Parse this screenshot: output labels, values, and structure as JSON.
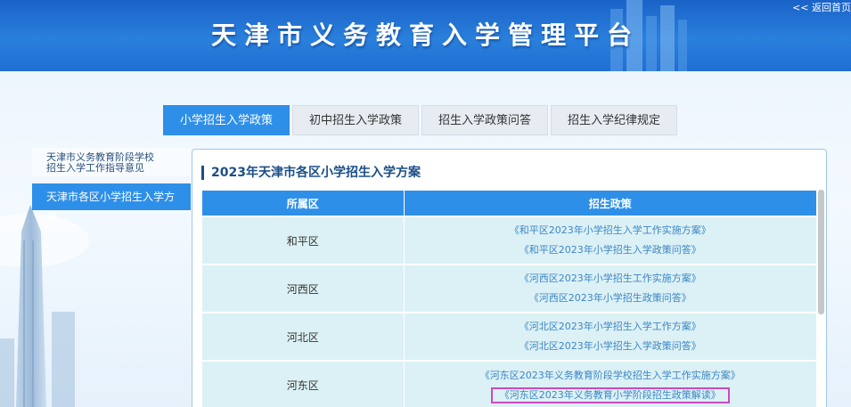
{
  "header": {
    "title": "天津市义务教育入学管理平台",
    "back_link": "<< 返回首页"
  },
  "tabs": [
    {
      "label": "小学招生入学政策",
      "active": true
    },
    {
      "label": "初中招生入学政策",
      "active": false
    },
    {
      "label": "招生入学政策问答",
      "active": false
    },
    {
      "label": "招生入学纪律规定",
      "active": false
    }
  ],
  "sidebar": {
    "items": [
      {
        "label": "天津市义务教育阶段学校\n招生入学工作指导意见",
        "active": false
      },
      {
        "label": "天津市各区小学招生入学方案",
        "active": true
      }
    ]
  },
  "main": {
    "title": "2023年天津市各区小学招生入学方案",
    "table": {
      "columns": [
        "所属区",
        "招生政策"
      ],
      "rows": [
        {
          "district": "和平区",
          "policies": [
            "《和平区2023年小学招生入学工作实施方案》",
            "《和平区2023年小学招生入学政策问答》"
          ]
        },
        {
          "district": "河西区",
          "policies": [
            "《河西区2023年小学招生工作实施方案》",
            "《河西区2023年小学招生政策问答》"
          ]
        },
        {
          "district": "河北区",
          "policies": [
            "《河北区2023年小学招生入学工作方案》",
            "《河北区2023年小学招生入学政策问答》"
          ]
        },
        {
          "district": "河东区",
          "policies": [
            "《河东区2023年义务教育阶段学校招生入学工作实施方案》",
            "《河东区2023年义务教育小学阶段招生政策解读》"
          ]
        }
      ]
    }
  },
  "colors": {
    "accent": "#2e8fe8",
    "header": "#1f6fd2",
    "row_bg": "#dcf1f5",
    "link": "#3d86c6",
    "highlight": "#c84ac0"
  }
}
